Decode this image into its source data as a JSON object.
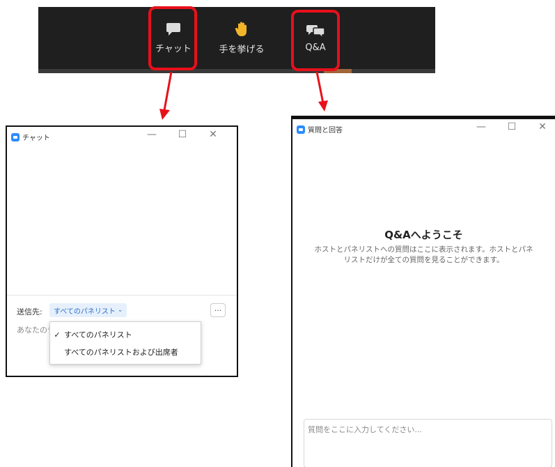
{
  "toolbar": {
    "chat_label": "チャット",
    "raise_hand_label": "手を挙げる",
    "qa_label": "Q&A"
  },
  "chat_window": {
    "title": "チャット",
    "minimize": "—",
    "maximize": "☐",
    "close": "✕",
    "send_to_label": "送信先:",
    "send_to_value": "すべてのパネリスト",
    "more_label": "···",
    "message_placeholder": "あなたのテ",
    "dropdown_options": [
      {
        "label": "すべてのパネリスト",
        "checked": true
      },
      {
        "label": "すべてのパネリストおよび出席者",
        "checked": false
      }
    ]
  },
  "qa_window": {
    "title": "質問と回答",
    "minimize": "—",
    "maximize": "☐",
    "close": "✕",
    "welcome_title": "Q&Aへようこそ",
    "welcome_line1": "ホストとパネリストへの質問はここに表示されます。ホストとパネ",
    "welcome_line2": "リストだけが全ての質問を見ることができます。",
    "input_placeholder": "質問をここに入力してください..."
  },
  "colors": {
    "highlight": "#e8101a",
    "toolbar_bg": "#1f1f1f",
    "zoom_blue": "#2d8cff"
  }
}
